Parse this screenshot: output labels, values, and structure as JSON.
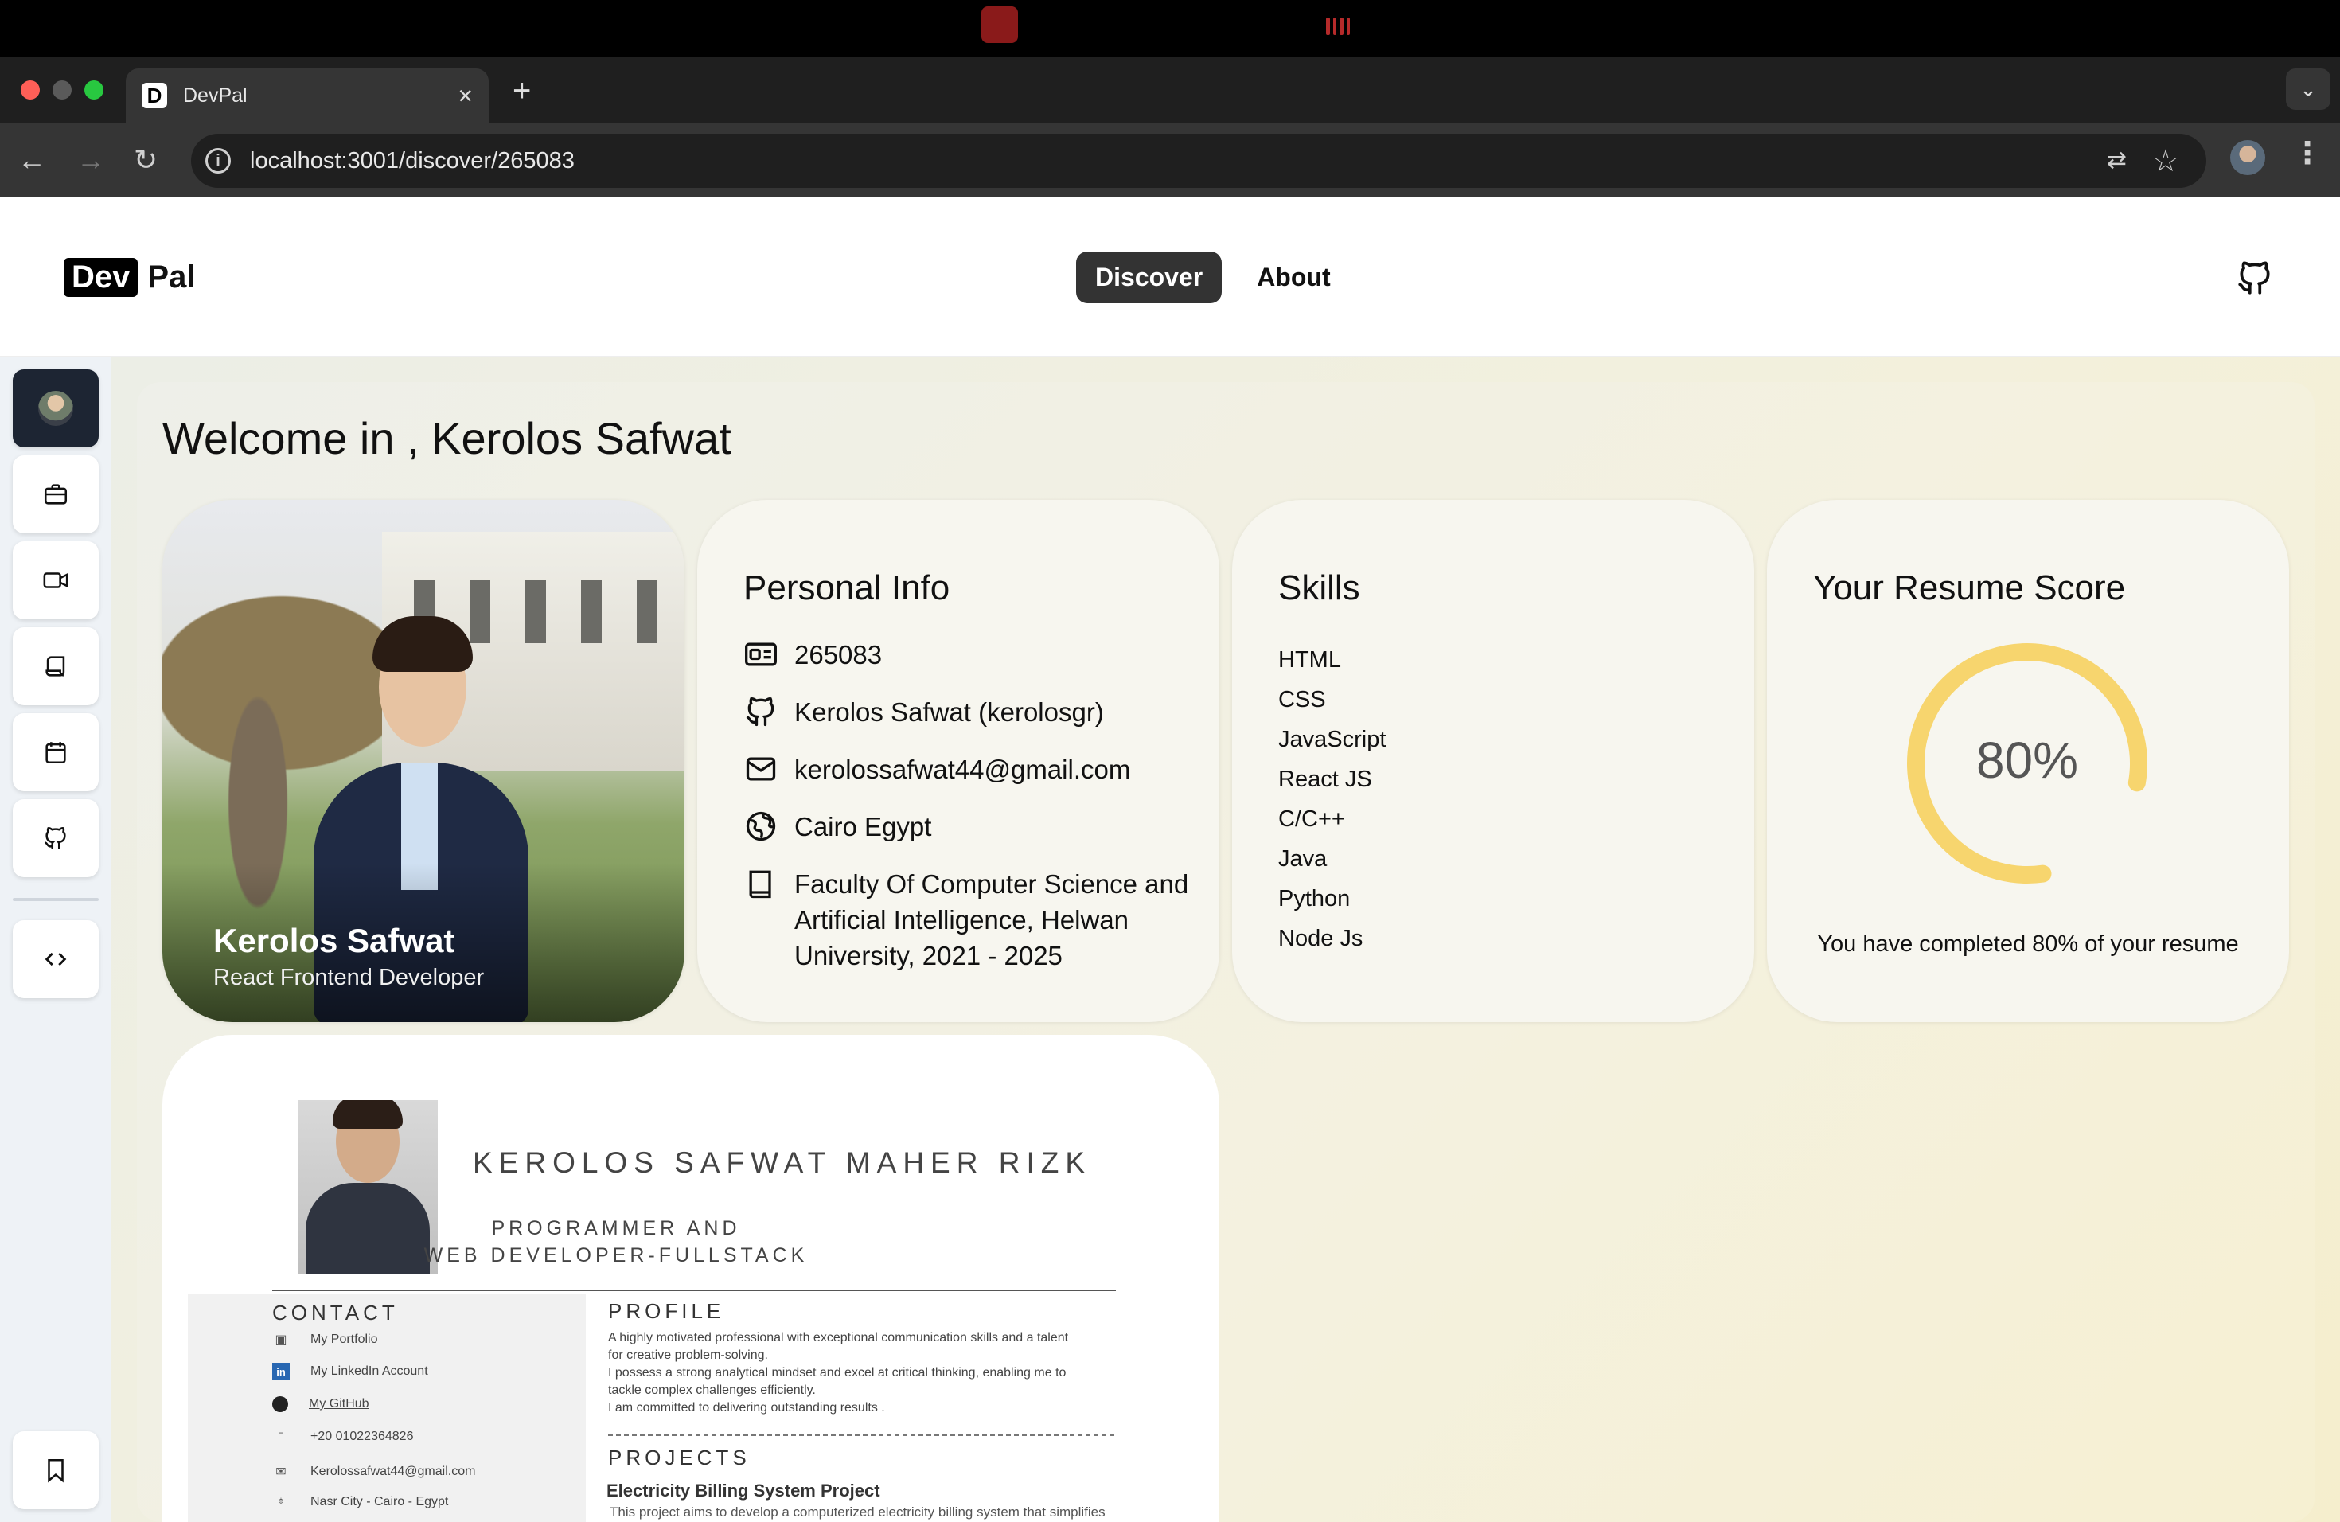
{
  "browser": {
    "tab_title": "DevPal",
    "tab_favicon": "D",
    "url": "localhost:3001/discover/265083"
  },
  "header": {
    "logo_dev": "Dev",
    "logo_pal": "Pal",
    "nav": {
      "discover": "Discover",
      "about": "About"
    }
  },
  "sidebar": {
    "items": [
      "profile-avatar",
      "briefcase-icon",
      "video-icon",
      "scroll-icon",
      "calendar-icon",
      "github-icon",
      "code-icon",
      "bookmark-icon"
    ]
  },
  "welcome": "Welcome in , Kerolos Safwat",
  "profile_card": {
    "name": "Kerolos Safwat",
    "role": "React Frontend Developer"
  },
  "personal_info": {
    "title": "Personal Info",
    "id": "265083",
    "github": "Kerolos Safwat (kerolosgr)",
    "email": "kerolossafwat44@gmail.com",
    "location": "Cairo Egypt",
    "education": "Faculty Of Computer Science and Artificial Intelligence, Helwan University, 2021 - 2025"
  },
  "skills": {
    "title": "Skills",
    "items": [
      "HTML",
      "CSS",
      "JavaScript",
      "React JS",
      "C/C++",
      "Java",
      "Python",
      "Node Js"
    ]
  },
  "resume_score": {
    "title": "Your Resume Score",
    "value_label": "80%",
    "value": 0.8,
    "caption": "You have completed 80% of your resume",
    "color": "#f7d56e"
  },
  "resume": {
    "name": "KEROLOS SAFWAT MAHER RIZK",
    "title_line1": "PROGRAMMER AND",
    "title_line2": "WEB DEVELOPER-FULLSTACK",
    "contact_title": "CONTACT",
    "contacts": {
      "portfolio": "My Portfolio",
      "linkedin": "My LinkedIn Account",
      "github": "My GitHub",
      "phone": "+20 01022364826",
      "email": "Kerolossafwat44@gmail.com",
      "address": "Nasr City - Cairo - Egypt"
    },
    "profile_title": "PROFILE",
    "profile_lines": [
      "A highly motivated professional with exceptional communication skills and a talent",
      "for creative problem-solving.",
      "I possess a strong analytical mindset and excel at critical thinking, enabling me to",
      "tackle complex challenges efficiently.",
      "I am committed to delivering outstanding results ."
    ],
    "projects_title": "PROJECTS",
    "project_name": "Electricity Billing System Project",
    "project_desc": "This project aims to develop a computerized electricity billing system that simplifies"
  }
}
